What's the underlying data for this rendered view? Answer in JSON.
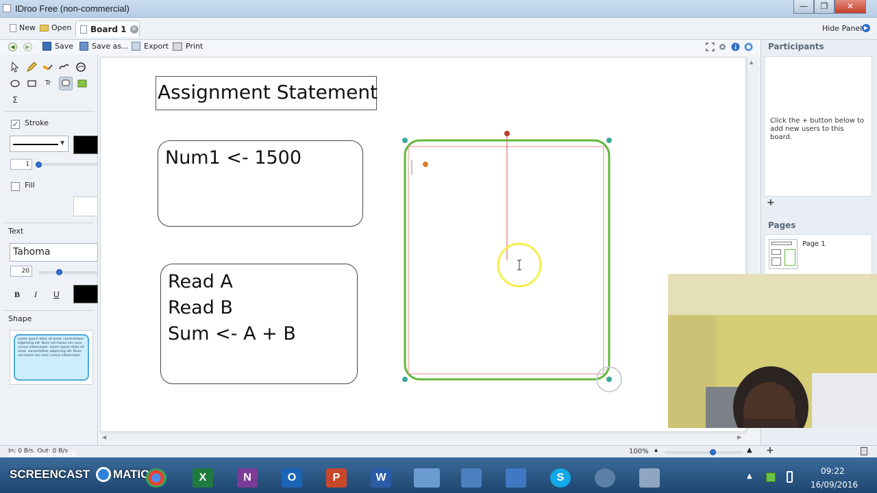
{
  "window": {
    "title": "IDroo Free (non-commercial)"
  },
  "tabrow": {
    "new_label": "New",
    "open_label": "Open",
    "board_tab": "Board 1",
    "hide_panels": "Hide Panels"
  },
  "toolbar": {
    "save_label": "Save",
    "save_as_label": "Save as...",
    "export_label": "Export",
    "print_label": "Print"
  },
  "left_panel": {
    "stroke_label": "Stroke",
    "stroke_width": "1",
    "fill_label": "Fill",
    "text_label": "Text",
    "font_name": "Tahoma",
    "font_size": "20",
    "bold": "B",
    "italic": "I",
    "underline": "U",
    "shape_label": "Shape",
    "shape_preview_text": "Lorem ipsum dolor sit amet, consectetuer adipiscing elit. Nunc vel massa nec nunc cursus ullamcorper. Lorem ipsum dolor sit amet, consectetuer adipiscing elit. Nunc vel massa nec nunc cursus ullamcorper.",
    "tools_row1": [
      "select-tool",
      "pencil-tool",
      "highlighter-tool",
      "polyline-tool",
      "eraser-tool"
    ],
    "tools_row2": [
      "ellipse-tool",
      "rectangle-tool",
      "text-tool",
      "callout-tool",
      "image-tool"
    ],
    "sigma_symbol": "Σ",
    "text_tool_glyph": "Tr"
  },
  "canvas": {
    "title_box": "Assignment Statement",
    "box1_lines": [
      "Num1 <- 1500"
    ],
    "box2_lines": [
      "Read A",
      "Read B",
      "Sum <- A + B"
    ]
  },
  "right_panel": {
    "participants_title": "Participants",
    "participants_hint": "Click the + button below to add new users to this board.",
    "add_symbol": "+",
    "pages_title": "Pages",
    "page1_label": "Page 1"
  },
  "statusbar": {
    "network": "In: 0 B/s, Out: 0 B/s",
    "zoom": "100%",
    "zoom_level": 0.5
  },
  "taskbar": {
    "watermark_top": "RECORDED WITH",
    "watermark_main": "SCREENCAST",
    "watermark_suffix": "MATIC",
    "time": "09:22",
    "date": "16/09/2016"
  },
  "colors": {
    "selection_green": "#5fb83a",
    "selection_handle": "#3aa89a",
    "guide_red": "#d9534f",
    "shape_preview_fill": "#cdeefc",
    "shape_preview_border": "#4aa9d8",
    "cursor_highlight": "#f3ee4a"
  }
}
